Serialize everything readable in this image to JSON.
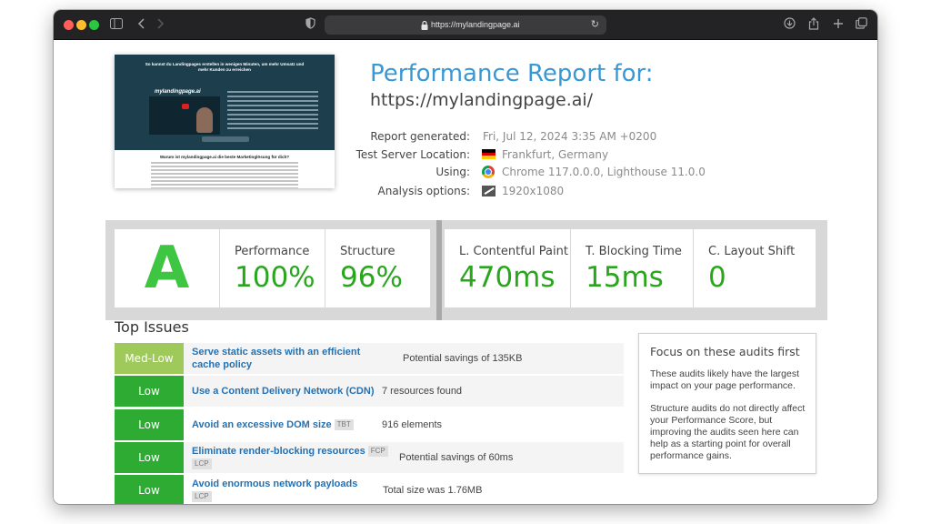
{
  "browser": {
    "url": "https://mylandingpage.ai",
    "traffic_lights": [
      "close",
      "minimize",
      "zoom"
    ]
  },
  "thumbnail": {
    "headline": "So kannst du Landingpages erstellen in wenigen Minuten, um mehr Umsatz und mehr Kunden zu erreichen",
    "logo_text": "mylandingpage.ai",
    "section_heading": "Warum ist mylandingpage.ai die beste Marketinglösung für dich?"
  },
  "report": {
    "title": "Performance Report for:",
    "url": "https://mylandingpage.ai/",
    "meta": [
      {
        "label": "Report generated:",
        "value": "Fri, Jul 12, 2024 3:35 AM +0200",
        "icon": ""
      },
      {
        "label": "Test Server Location:",
        "value": "Frankfurt, Germany",
        "icon": "germany-flag-icon"
      },
      {
        "label": "Using:",
        "value": "Chrome 117.0.0.0, Lighthouse 11.0.0",
        "icon": "chrome-icon"
      },
      {
        "label": "Analysis options:",
        "value": "1920x1080",
        "icon": "viewport-icon"
      }
    ]
  },
  "scores": {
    "grade": "A",
    "grade_color": "#3ec541",
    "performance_label": "Performance",
    "performance_value": "100%",
    "structure_label": "Structure",
    "structure_value": "96%",
    "lcp_label": "L. Contentful Paint",
    "lcp_value": "470ms",
    "tbt_label": "T. Blocking Time",
    "tbt_value": "15ms",
    "cls_label": "C. Layout Shift",
    "cls_value": "0",
    "value_color": "#2aa61e"
  },
  "issues": {
    "title": "Top Issues",
    "rows": [
      {
        "severity": "Med-Low",
        "name": "Serve static assets with an efficient cache policy",
        "tags": [],
        "detail": "Potential savings of 135KB"
      },
      {
        "severity": "Low",
        "name": "Use a Content Delivery Network (CDN)",
        "tags": [],
        "detail": "7 resources found"
      },
      {
        "severity": "Low",
        "name": "Avoid an excessive DOM size",
        "tags": [
          "TBT"
        ],
        "detail": "916 elements"
      },
      {
        "severity": "Low",
        "name": "Eliminate render-blocking resources",
        "tags": [
          "FCP",
          "LCP"
        ],
        "detail": "Potential savings of 60ms"
      },
      {
        "severity": "Low",
        "name": "Avoid enormous network payloads",
        "tags": [
          "LCP"
        ],
        "detail": "Total size was 1.76MB"
      }
    ]
  },
  "focus": {
    "title": "Focus on these audits first",
    "p1": "These audits likely have the largest impact on your page performance.",
    "p2": "Structure audits do not directly affect your Performance Score, but improving the audits seen here can help as a starting point for overall performance gains."
  }
}
